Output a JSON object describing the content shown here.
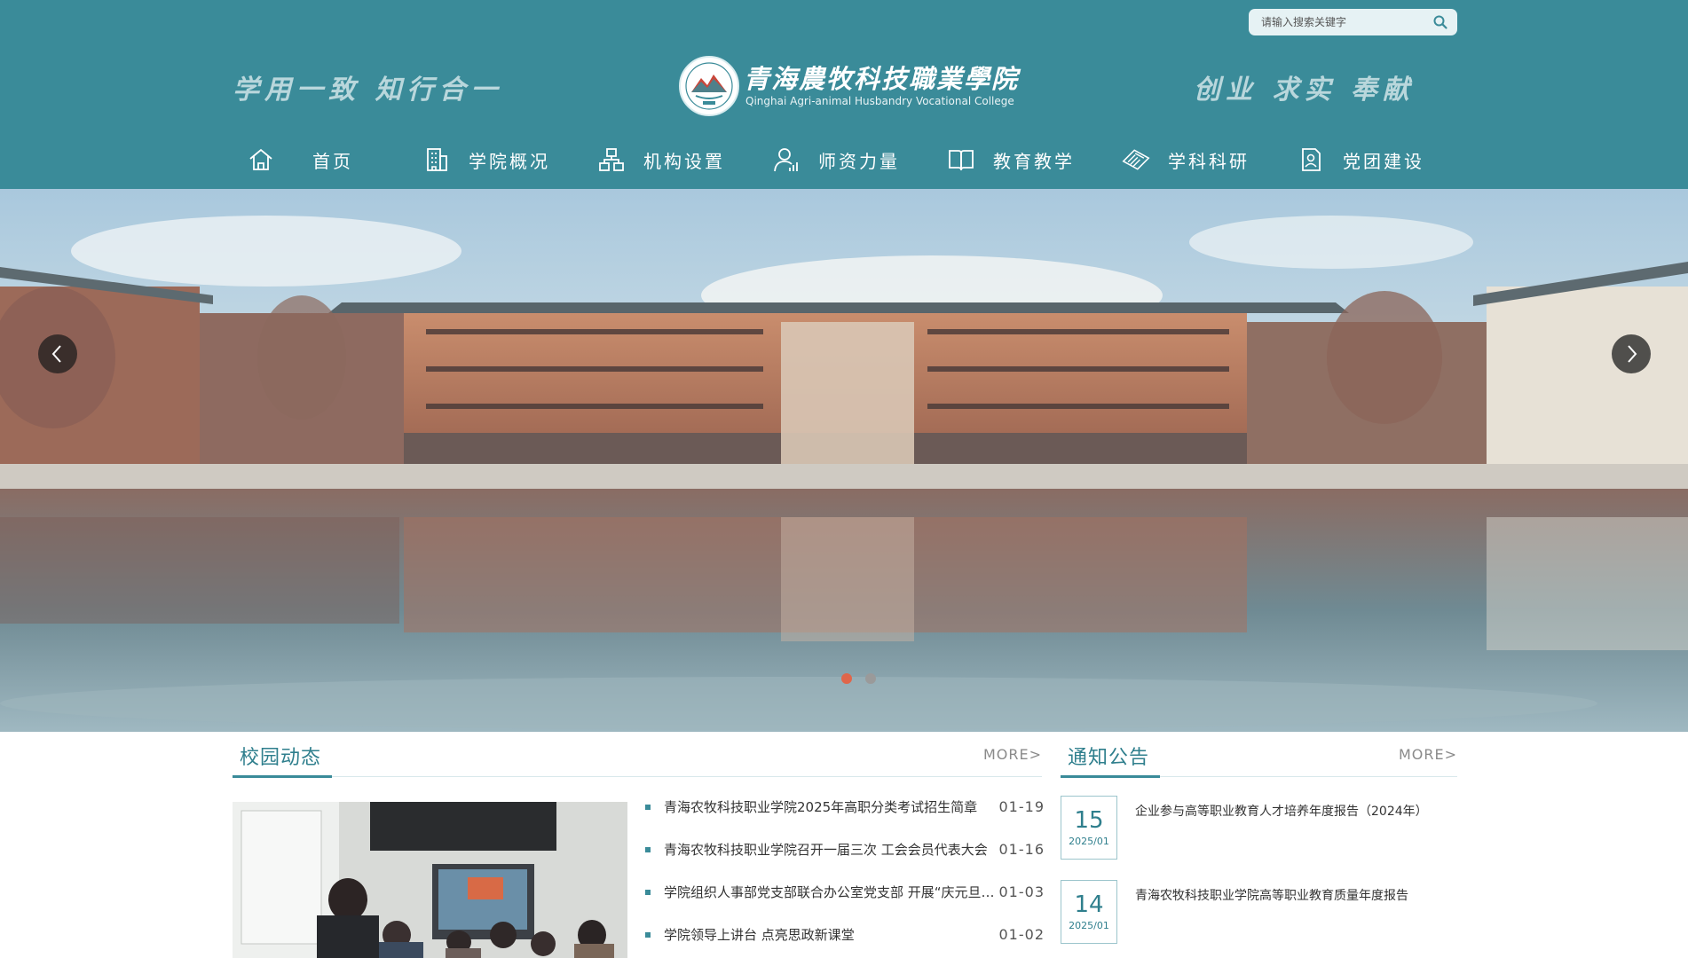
{
  "header": {
    "search_placeholder": "请输入搜索关键字",
    "motto_left": "学用一致  知行合一",
    "motto_right": "创业  求实  奉献",
    "logo_cn": "青海農牧科技職業學院",
    "logo_en": "Qinghai Agri-animal Husbandry Vocational College",
    "bg_color": "#3a8b99"
  },
  "nav": {
    "items": [
      {
        "label": "首页",
        "icon": "home-icon"
      },
      {
        "label": "学院概况",
        "icon": "building-icon"
      },
      {
        "label": "机构设置",
        "icon": "org-chart-icon"
      },
      {
        "label": "师资力量",
        "icon": "teacher-icon"
      },
      {
        "label": "教育教学",
        "icon": "book-icon"
      },
      {
        "label": "学科科研",
        "icon": "research-icon"
      },
      {
        "label": "党团建设",
        "icon": "party-icon"
      }
    ]
  },
  "banner": {
    "active_slide": 1,
    "slide_count": 2,
    "active_color": "#e0664a",
    "inactive_color": "#9a9a9a"
  },
  "news": {
    "title": "校园动态",
    "more": "MORE>",
    "items": [
      {
        "title": "青海农牧科技职业学院2025年高职分类考试招生简章",
        "date": "01-19"
      },
      {
        "title": "青海农牧科技职业学院召开一届三次 工会会员代表大会",
        "date": "01-16"
      },
      {
        "title": "学院组织人事部党支部联合办公室党支部 开展“庆元旦，迎新年”主题党日活动",
        "date": "01-03"
      },
      {
        "title": " 学院领导上讲台 点亮思政新课堂",
        "date": "01-02"
      }
    ]
  },
  "notices": {
    "title": "通知公告",
    "more": "MORE>",
    "items": [
      {
        "day": "15",
        "ym": "2025/01",
        "title": "企业参与高等职业教育人才培养年度报告（2024年）"
      },
      {
        "day": "14",
        "ym": "2025/01",
        "title": "青海农牧科技职业学院高等职业教育质量年度报告"
      }
    ]
  }
}
